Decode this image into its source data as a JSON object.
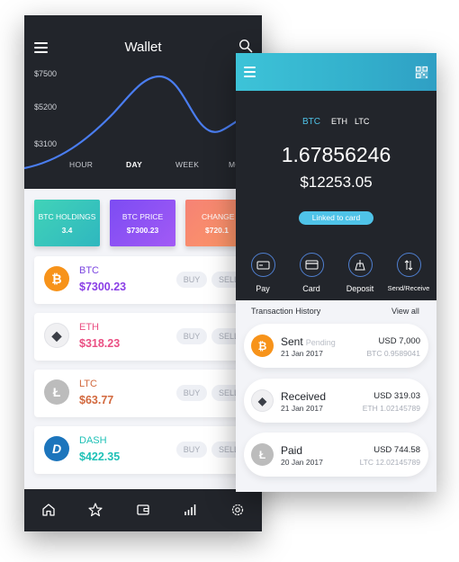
{
  "wallet_screen": {
    "title": "Wallet",
    "chart_data": {
      "type": "line",
      "title": "",
      "y_tick_labels": [
        "$7500",
        "$5200",
        "$3100"
      ],
      "x_tick_labels": [
        "HOUR",
        "DAY",
        "WEEK",
        "MO"
      ],
      "active_range": "DAY",
      "color": "#4a7df0"
    },
    "stats": [
      {
        "label": "BTC HOLDINGS",
        "value": "3.4",
        "gradient": [
          "#41d3b8",
          "#2fb7bf"
        ]
      },
      {
        "label": "BTC PRICE",
        "value": "$7300.23",
        "gradient": [
          "#7c4cf3",
          "#a25af5"
        ]
      },
      {
        "label": "CHANGE",
        "value": "$720.1",
        "gradient": [
          "#f58275",
          "#ff9c62"
        ]
      }
    ],
    "coins": [
      {
        "symbol": "BTC",
        "price": "$7300.23",
        "price_color": "#8a3ee6",
        "icon": "bitcoin-icon",
        "icon_bg": "#f7931a",
        "glyph": "₿",
        "buy": "BUY",
        "sell": "SELL"
      },
      {
        "symbol": "ETH",
        "price": "$318.23",
        "price_color": "#ea4f83",
        "icon": "ethereum-icon",
        "icon_bg": "#f0f0f2",
        "glyph": "◆",
        "buy": "BUY",
        "sell": "SELL"
      },
      {
        "symbol": "LTC",
        "price": "$63.77",
        "price_color": "#d2683d",
        "icon": "litecoin-icon",
        "icon_bg": "#bcbcbc",
        "glyph": "Ł",
        "buy": "BUY",
        "sell": "SELL"
      },
      {
        "symbol": "DASH",
        "price": "$422.35",
        "price_color": "#1fc1b7",
        "icon": "dash-icon",
        "icon_bg": "#1c75bc",
        "glyph": "D",
        "buy": "BUY",
        "sell": "SELL"
      }
    ],
    "nav": [
      "home-icon",
      "star-icon",
      "wallet-icon",
      "chart-bars-icon",
      "settings-icon"
    ]
  },
  "coin_screen": {
    "currency_tabs": [
      "BTC",
      "ETH",
      "LTC"
    ],
    "active_tab": "BTC",
    "amount": "1.67856246",
    "usd_value": "$12253.05",
    "linked_label": "Linked to card",
    "actions": [
      {
        "label": "Pay",
        "icon": "pay-icon"
      },
      {
        "label": "Card",
        "icon": "card-icon"
      },
      {
        "label": "Deposit",
        "icon": "deposit-icon"
      },
      {
        "label": "Send/Receive",
        "icon": "send-receive-icon"
      }
    ],
    "history_title": "Transaction History",
    "view_all": "View all",
    "transactions": [
      {
        "type": "Sent",
        "status": "Pending",
        "date": "21 Jan 2017",
        "usd": "USD 7,000",
        "crypto": "BTC 0.9589041",
        "icon": "bitcoin-icon",
        "icon_bg": "#f7931a",
        "glyph": "₿"
      },
      {
        "type": "Received",
        "status": "",
        "date": "21 Jan 2017",
        "usd": "USD 319.03",
        "crypto": "ETH 1.02145789",
        "icon": "ethereum-icon",
        "icon_bg": "#f0f0f2",
        "glyph": "◆"
      },
      {
        "type": "Paid",
        "status": "",
        "date": "20 Jan 2017",
        "usd": "USD 744.58",
        "crypto": "LTC 12.02145789",
        "icon": "litecoin-icon",
        "icon_bg": "#bcbcbc",
        "glyph": "Ł"
      }
    ]
  }
}
